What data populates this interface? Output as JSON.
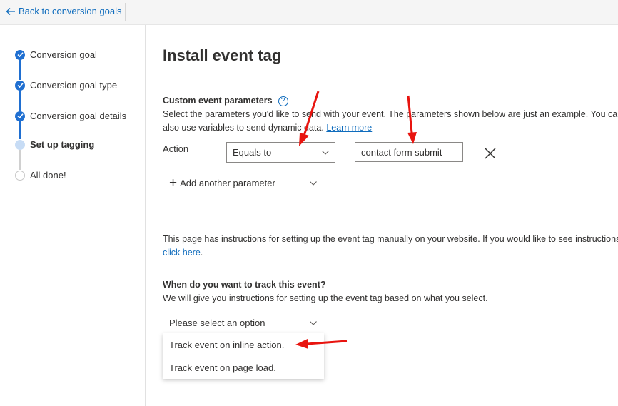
{
  "topbar": {
    "back_label": "Back to conversion goals"
  },
  "steps": [
    {
      "label": "Conversion goal",
      "state": "done"
    },
    {
      "label": "Conversion goal type",
      "state": "done"
    },
    {
      "label": "Conversion goal details",
      "state": "done"
    },
    {
      "label": "Set up tagging",
      "state": "current"
    },
    {
      "label": "All done!",
      "state": "todo"
    }
  ],
  "main": {
    "title": "Install event tag",
    "params_heading": "Custom event parameters",
    "help_glyph": "?",
    "params_desc_line1": "Select the parameters you'd like to send with your event. The parameters shown below are just an example. You can",
    "params_desc_line2": "also use variables to send dynamic data.",
    "learn_more": "Learn more",
    "action_label": "Action",
    "operator_value": "Equals to",
    "action_value": "contact form submit",
    "add_param_label": "Add another parameter",
    "manual_line1": "This page has instructions for setting up the event tag manually on your website. If you would like to see instructions",
    "click_here": "click here",
    "manual_period": ".",
    "track_heading": "When do you want to track this event?",
    "track_desc": "We will give you instructions for setting up the event tag based on what you select.",
    "track_placeholder": "Please select an option",
    "track_options": [
      "Track event on inline action.",
      "Track event on page load."
    ]
  },
  "colors": {
    "accent": "#1f6fd1",
    "link": "#0f6cbd",
    "annotation_arrow": "#e8140f"
  },
  "icons": {
    "back": "arrow-left-icon",
    "done": "checkmark-icon",
    "close": "close-icon",
    "add": "plus-icon",
    "dropdown": "chevron-down-icon",
    "help": "help-circle-icon"
  }
}
